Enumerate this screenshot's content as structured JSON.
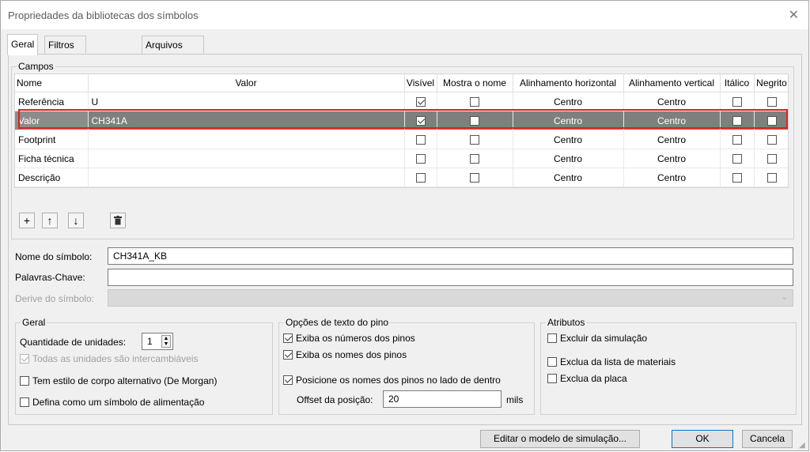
{
  "window": {
    "title": "Propriedades da bibliotecas dos símbolos",
    "close_glyph": "✕"
  },
  "tabs": [
    {
      "label": "Geral",
      "active": true
    },
    {
      "label": "Filtros do footprint",
      "active": false
    },
    {
      "label": "Arquivos incorporados",
      "active": false
    }
  ],
  "campos": {
    "legend": "Campos",
    "columns": [
      "Nome",
      "Valor",
      "Visível",
      "Mostra o nome",
      "Alinhamento horizontal",
      "Alinhamento vertical",
      "Itálico",
      "Negrito"
    ],
    "rows": [
      {
        "name": "Referência",
        "value": "U",
        "visible": true,
        "show_name": false,
        "h_align": "Centro",
        "v_align": "Centro",
        "italic": false,
        "bold": false,
        "selected": false
      },
      {
        "name": "Valor",
        "value": "CH341A",
        "visible": true,
        "show_name": false,
        "h_align": "Centro",
        "v_align": "Centro",
        "italic": false,
        "bold": false,
        "selected": true
      },
      {
        "name": "Footprint",
        "value": "",
        "visible": false,
        "show_name": false,
        "h_align": "Centro",
        "v_align": "Centro",
        "italic": false,
        "bold": false,
        "selected": false
      },
      {
        "name": "Ficha técnica",
        "value": "",
        "visible": false,
        "show_name": false,
        "h_align": "Centro",
        "v_align": "Centro",
        "italic": false,
        "bold": false,
        "selected": false
      },
      {
        "name": "Descrição",
        "value": "",
        "visible": false,
        "show_name": false,
        "h_align": "Centro",
        "v_align": "Centro",
        "italic": false,
        "bold": false,
        "selected": false
      }
    ],
    "toolbar": {
      "add_icon": "plus-icon",
      "up_icon": "arrow-up-icon",
      "down_icon": "arrow-down-icon",
      "delete_icon": "trash-icon"
    }
  },
  "symbol": {
    "name_label": "Nome do símbolo:",
    "name_value": "CH341A_KB",
    "keywords_label": "Palavras-Chave:",
    "keywords_value": "",
    "derive_label": "Derive do símbolo:",
    "derive_value": ""
  },
  "geral": {
    "legend": "Geral",
    "units_label": "Quantidade de unidades:",
    "units_value": "1",
    "interchangeable_label": "Todas as unidades são intercambiáveis",
    "interchangeable_checked": true,
    "demorgan_label": "Tem estilo de corpo alternativo (De Morgan)",
    "demorgan_checked": false,
    "power_label": "Defina como um símbolo de alimentação",
    "power_checked": false
  },
  "pin_text": {
    "legend": "Opções de texto do pino",
    "show_numbers_label": "Exiba os números dos pinos",
    "show_numbers_checked": true,
    "show_names_label": "Exiba os nomes dos pinos",
    "show_names_checked": true,
    "inside_label": "Posicione os nomes dos pinos no lado de dentro",
    "inside_checked": true,
    "offset_label": "Offset da posição:",
    "offset_value": "20",
    "offset_unit": "mils"
  },
  "attributes": {
    "legend": "Atributos",
    "exclude_sim_label": "Excluir da simulação",
    "exclude_sim_checked": false,
    "exclude_bom_label": "Exclua da lista de materiais",
    "exclude_bom_checked": false,
    "exclude_board_label": "Exclua da placa",
    "exclude_board_checked": false
  },
  "buttons": {
    "edit_sim": "Editar o modelo de simulação...",
    "ok": "OK",
    "cancel": "Cancela"
  }
}
